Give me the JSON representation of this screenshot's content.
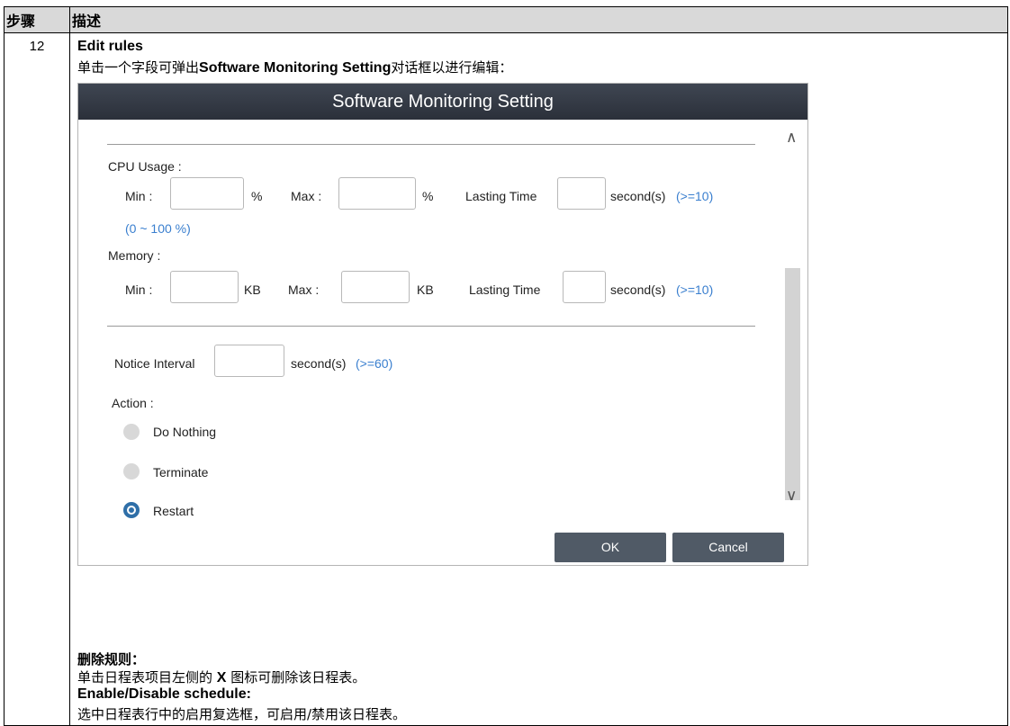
{
  "table": {
    "header_step": "步骤",
    "header_desc": "描述",
    "step_number": "12"
  },
  "edit": {
    "title": "Edit rules",
    "desc_prefix": "单击一个字段可弹出",
    "desc_bold": "Software Monitoring Setting",
    "desc_suffix": "对话框以进行编辑："
  },
  "dialog": {
    "title": "Software Monitoring Setting",
    "cpu_label": "CPU Usage :",
    "min_label": "Min :",
    "max_label": "Max :",
    "percent": "%",
    "kb": "KB",
    "lasting_time": "Lasting Time",
    "seconds": "second(s)",
    "ge10": "(>=10)",
    "cpu_range": "(0 ~ 100 %)",
    "memory_label": "Memory :",
    "notice_interval": "Notice Interval",
    "ge60": "(>=60)",
    "action_label": "Action :",
    "actions": [
      "Do Nothing",
      "Terminate",
      "Restart"
    ],
    "selected_action": "Restart",
    "ok": "OK",
    "cancel": "Cancel",
    "fields": {
      "cpu_min": "",
      "cpu_max": "",
      "cpu_lasting": "",
      "mem_min": "",
      "mem_max": "",
      "mem_lasting": "",
      "notice_interval": ""
    }
  },
  "notes": {
    "delete_title": "删除规则：",
    "delete_prefix": "单击日程表项目左侧的 ",
    "delete_x": "X",
    "delete_suffix": " 图标可删除该日程表。",
    "enable_title": "Enable/Disable schedule:",
    "enable_desc": "选中日程表行中的启用复选框，可启用/禁用该日程表。"
  },
  "colors": {
    "title_bar": "#2f343d",
    "hint": "#3a7fcf",
    "button": "#505a66",
    "radio_selected": "#2f6fa8"
  }
}
